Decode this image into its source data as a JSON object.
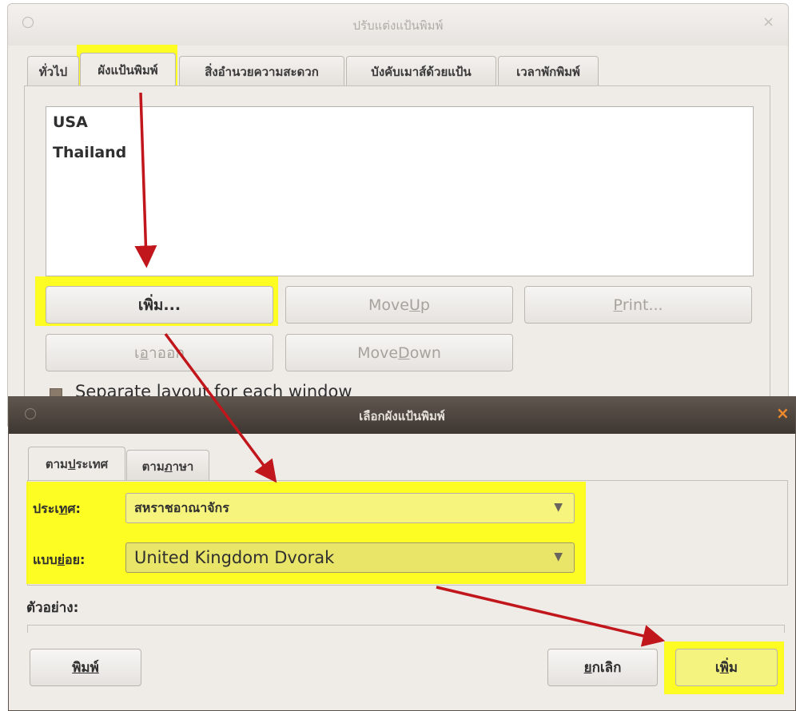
{
  "background_window": {
    "title": "ปรับแต่งแป้นพิมพ์",
    "close_glyph": "×",
    "tabs": [
      {
        "label": "ทั่วไป",
        "active": false
      },
      {
        "label": "ผังแป้นพิมพ์",
        "active": true
      },
      {
        "label": "สิ่งอำนวยความสะดวก",
        "active": false
      },
      {
        "label": "บังคับเมาส์ด้วยแป้น",
        "active": false
      },
      {
        "label": "เวลาพักพิมพ์",
        "active": false
      }
    ],
    "layouts": [
      "USA",
      "Thailand"
    ],
    "buttons": {
      "add": "เพิ่ม...",
      "move_up_pre": "Move ",
      "move_up_u": "U",
      "move_up_post": "p",
      "print_u": "P",
      "print_post": "rint...",
      "remove_pre": "เ",
      "remove_u": "อ",
      "remove_post": "าออก",
      "move_down_pre": "Move ",
      "move_down_u": "D",
      "move_down_post": "own"
    },
    "separate_layout_label": "Separate layout for each window"
  },
  "dialog": {
    "title": "เลือกผังแป้นพิมพ์",
    "close_glyph": "×",
    "tabs": [
      {
        "pre": "ตาม",
        "u": "ป",
        "post": "ระเทศ",
        "active": true
      },
      {
        "pre": "ตาม",
        "u": "ภ",
        "post": "าษา",
        "active": false
      }
    ],
    "country_label_pre": "ประเ",
    "country_label_u": "ท",
    "country_label_post": "ศ:",
    "country_value": "สหราชอาณาจักร",
    "variant_label_pre": "แบบ",
    "variant_label_u": "ย่",
    "variant_label_post": "อย:",
    "variant_value": "United Kingdom Dvorak",
    "combo_arrow": "▼",
    "preview_label": "ตัวอย่าง:",
    "buttons": {
      "print": "พิมพ์",
      "cancel_pre": "ย",
      "cancel_post": "กเลิก",
      "add_pre": "เ",
      "add_u": "พิ",
      "add_post": "่ม"
    }
  },
  "colors": {
    "highlight": "#ffff00",
    "annotation_arrow": "#c0161c",
    "dialog_titlebar": "#4a423b",
    "close_orange": "#f08a2b"
  }
}
